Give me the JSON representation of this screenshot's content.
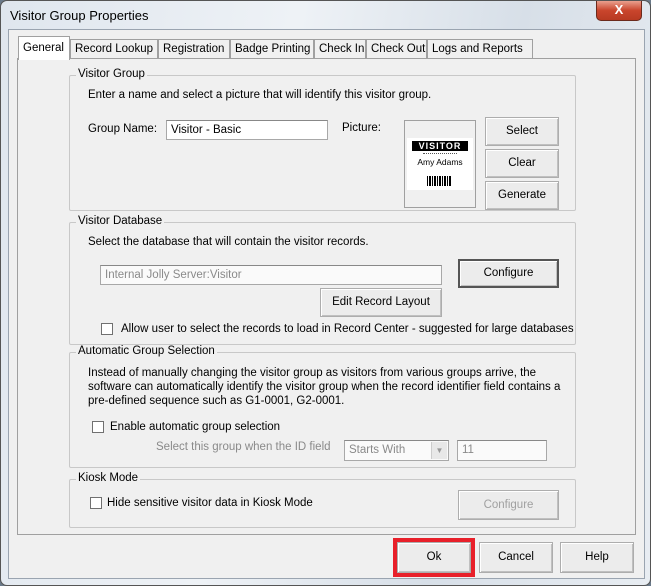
{
  "window": {
    "title": "Visitor Group Properties",
    "close_glyph": "X"
  },
  "tabs": [
    {
      "label": "General",
      "active": true
    },
    {
      "label": "Record Lookup"
    },
    {
      "label": "Registration"
    },
    {
      "label": "Badge Printing"
    },
    {
      "label": "Check In"
    },
    {
      "label": "Check Out"
    },
    {
      "label": "Logs and Reports"
    }
  ],
  "visitor_group": {
    "title": "Visitor Group",
    "instructions": "Enter a name and select a picture that will identify this visitor group.",
    "name_label": "Group Name:",
    "name_value": "Visitor - Basic",
    "picture_label": "Picture:",
    "badge": {
      "header": "VISITOR",
      "name": "Amy Adams"
    },
    "select": "Select",
    "clear": "Clear",
    "generate": "Generate"
  },
  "visitor_database": {
    "title": "Visitor Database",
    "instructions": "Select the database that will contain the visitor records.",
    "database_value": "Internal Jolly Server:Visitor",
    "configure": "Configure",
    "edit_layout": "Edit Record Layout",
    "allow_select_label": "Allow user to select the records to load in Record Center - suggested for large databases",
    "allow_select_checked": false
  },
  "auto_group": {
    "title": "Automatic Group Selection",
    "description": [
      "Instead of manually changing the visitor group as visitors from various groups arrive, the",
      "software can automatically identify the visitor group when the record identifier field contains a",
      "pre-defined sequence such as G1-0001, G2-0001."
    ],
    "enable_label": "Enable automatic group selection",
    "enable_checked": false,
    "condition_label": "Select this group when the ID field",
    "condition_value": "Starts With",
    "match_value": "11"
  },
  "kiosk": {
    "title": "Kiosk Mode",
    "hide_label": "Hide sensitive visitor data in Kiosk Mode",
    "hide_checked": false,
    "configure": "Configure"
  },
  "footer": {
    "ok": "Ok",
    "cancel": "Cancel",
    "help": "Help",
    "highlight_color": "#e8202a"
  }
}
